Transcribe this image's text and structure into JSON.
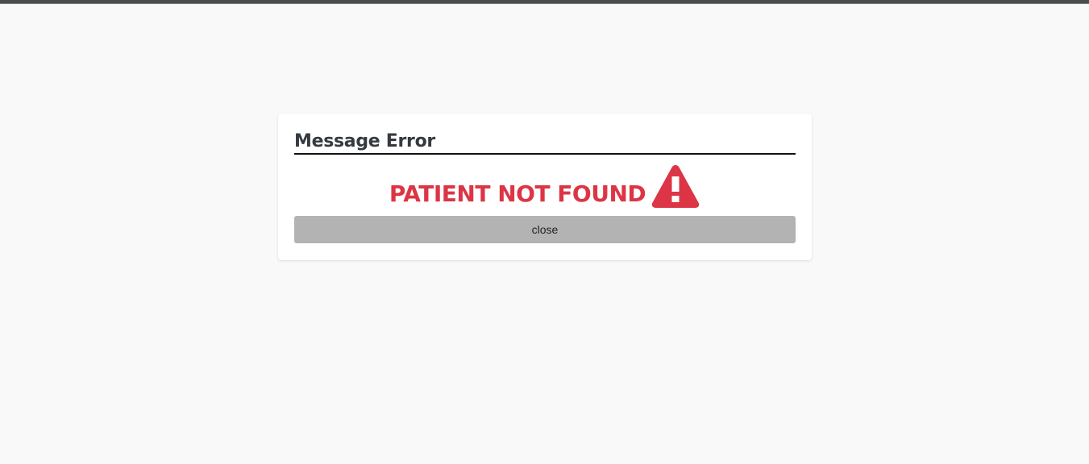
{
  "dialog": {
    "title": "Message Error",
    "message": "PATIENT NOT FOUND",
    "icon": "warning-triangle-icon",
    "close_label": "close"
  },
  "colors": {
    "error": "#dc3545",
    "button_bg": "#b3b3b3",
    "page_bg": "#f9f9f9"
  }
}
